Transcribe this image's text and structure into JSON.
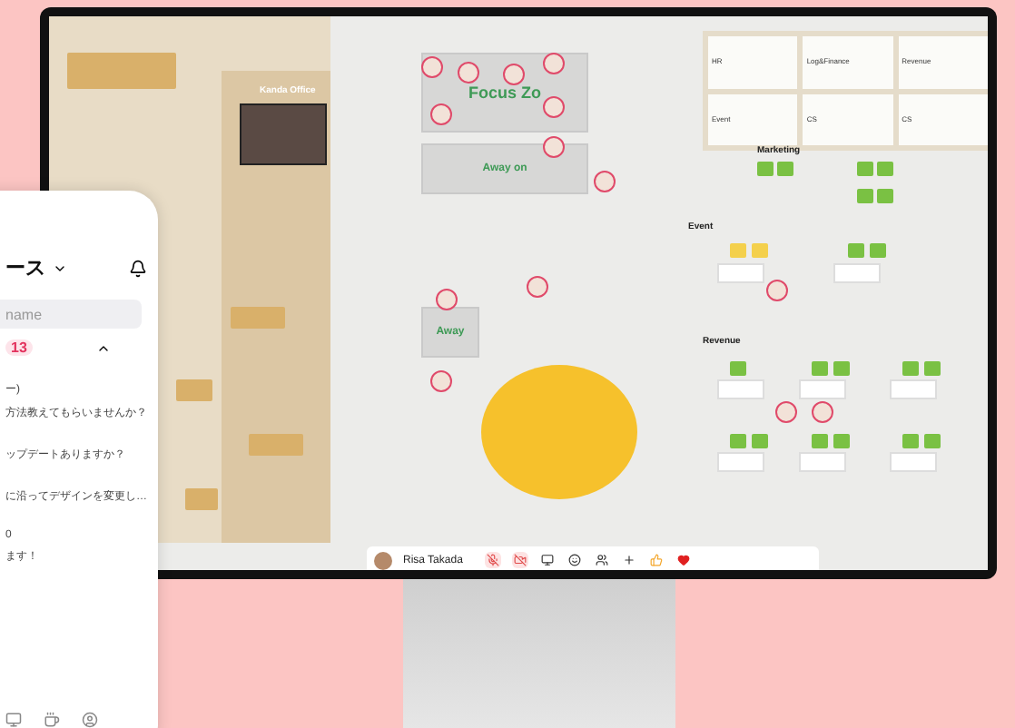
{
  "office": {
    "room_label": "Kanda Office",
    "zones": [
      {
        "kind": "focus",
        "label": "Focus Zo"
      },
      {
        "kind": "away",
        "label": "Away on"
      },
      {
        "kind": "small",
        "label": "Away"
      }
    ],
    "panels": [
      {
        "title": "HR"
      },
      {
        "title": "Log&Finance"
      },
      {
        "title": "Revenue"
      },
      {
        "title": "Event"
      },
      {
        "title": "CS"
      },
      {
        "title": "CS"
      }
    ],
    "groups": [
      {
        "label": "Marketing"
      },
      {
        "label": "Event"
      },
      {
        "label": "Revenue"
      }
    ]
  },
  "toolbar": {
    "user": "Risa Takada",
    "mic_muted": true,
    "camera_off": true
  },
  "phone": {
    "title": "ース",
    "search": {
      "placeholder": "name"
    },
    "badge": "13",
    "expanded": true,
    "messages": [
      {
        "lines": [
          "ー)",
          "方法教えてもらいませんか？"
        ]
      },
      {
        "lines": [
          "ップデートありますか？"
        ]
      },
      {
        "lines": [
          "に沿ってデザインを変更し…"
        ]
      },
      {
        "lines": [
          "0",
          "ます！"
        ]
      }
    ]
  }
}
